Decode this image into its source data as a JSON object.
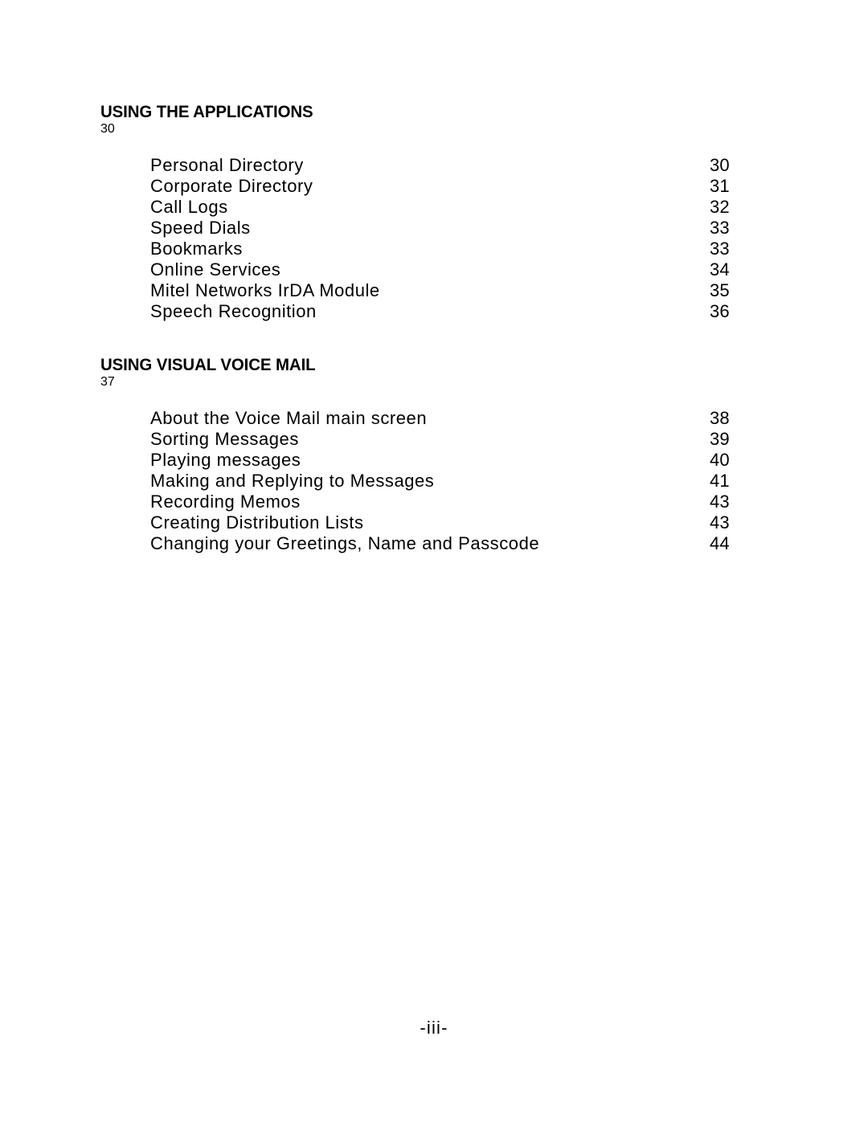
{
  "document": {
    "type": "table-of-contents",
    "folio": "-iii-"
  },
  "sections": [
    {
      "title": "USING THE APPLICATIONS",
      "page": "30",
      "entries": [
        {
          "title": "Personal Directory",
          "page": "30"
        },
        {
          "title": "Corporate Directory",
          "page": "31"
        },
        {
          "title": "Call Logs",
          "page": "32"
        },
        {
          "title": "Speed Dials",
          "page": "33"
        },
        {
          "title": "Bookmarks",
          "page": "33"
        },
        {
          "title": "Online Services",
          "page": "34"
        },
        {
          "title": "Mitel Networks IrDA Module",
          "page": "35"
        },
        {
          "title": "Speech Recognition",
          "page": "36"
        }
      ]
    },
    {
      "title": "USING VISUAL VOICE MAIL",
      "page": "37",
      "entries": [
        {
          "title": "About the Voice Mail main screen",
          "page": "38"
        },
        {
          "title": "Sorting Messages",
          "page": "39"
        },
        {
          "title": "Playing messages",
          "page": "40"
        },
        {
          "title": "Making and Replying to Messages",
          "page": "41"
        },
        {
          "title": "Recording Memos",
          "page": "43"
        },
        {
          "title": "Creating Distribution Lists",
          "page": "43"
        },
        {
          "title": "Changing your Greetings, Name and Passcode",
          "page": "44"
        }
      ]
    }
  ]
}
